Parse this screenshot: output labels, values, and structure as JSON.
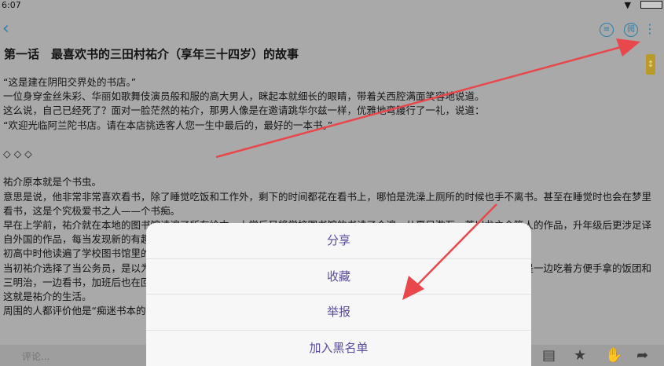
{
  "status": {
    "time": "6:07"
  },
  "header": {
    "list_icon": "list-icon",
    "read_icon_label": "阅"
  },
  "chapter": {
    "title": "第一话　最喜欢书的三田村祐介（享年三十四岁）的故事",
    "paragraphs": [
      "“这是建在阴阳交界处的书店。”",
      "一位身穿金丝朱彩、华丽如歌舞伎演员般和服的高大男人，眯起本就细长的眼睛，带着关西腔满面笑容地说道。",
      "这么说，自己已经死了？面对一脸茫然的祐介，那男人像是在邀请跳华尔兹一样，优雅地弯腰行了一礼，说道：",
      "“欢迎光临阿兰陀书店。请在本店挑选客人您一生中最后的，最好的一本书。”",
      "",
      "◇ ◇ ◇",
      "",
      "祐介原本就是个书虫。",
      "意思是说，他非常非常喜欢看书，除了睡觉吃饭和工作外，剩下的时间都花在看书上，哪怕是洗澡上厕所的时候也手不离书。甚至在睡觉时也会在梦里看书，这是个究极爱书之人——个书痴。",
      "早在上学前，祐介就在本地的图书馆读遍了所有绘本，上学后又将学校图书馆的书读了个遍，从夏目漱石、芥川龙之介等人的作品，升年级后更涉足译自外国的作品，每当发现新的有趣故事，就会如饥似渴、不眠不休、废寝忘食、不停地读下去，祐介就激动地颤抖。",
      "初高中时他读遍了学校图书馆里的书。",
      "当初祐介选择了当公务员，是以为这样就有更多的时间看书，结果却没想到工作意外地非常忙碌。即便如此，午休时他还是一边吃着方便手拿的饭团和三明治，一边看书，加班后也在回家的电车里看书，只为了能实书回家直接读上。",
      "这就是祐介的生活。",
      "周围的人都评价他是“痴迷书本的"
    ]
  },
  "bottom_bar": {
    "comment_placeholder": "评论...",
    "icons": [
      "comment-icon",
      "star-icon",
      "thumbs-up-icon",
      "share-icon"
    ]
  },
  "action_sheet": {
    "items": [
      "分享",
      "收藏",
      "举报",
      "加入黑名单"
    ]
  },
  "colors": {
    "accent": "#2e7fa6",
    "sheet_text": "#5a4a9a",
    "overlay": "#a9a9a9",
    "arrow": "#e8474b"
  }
}
